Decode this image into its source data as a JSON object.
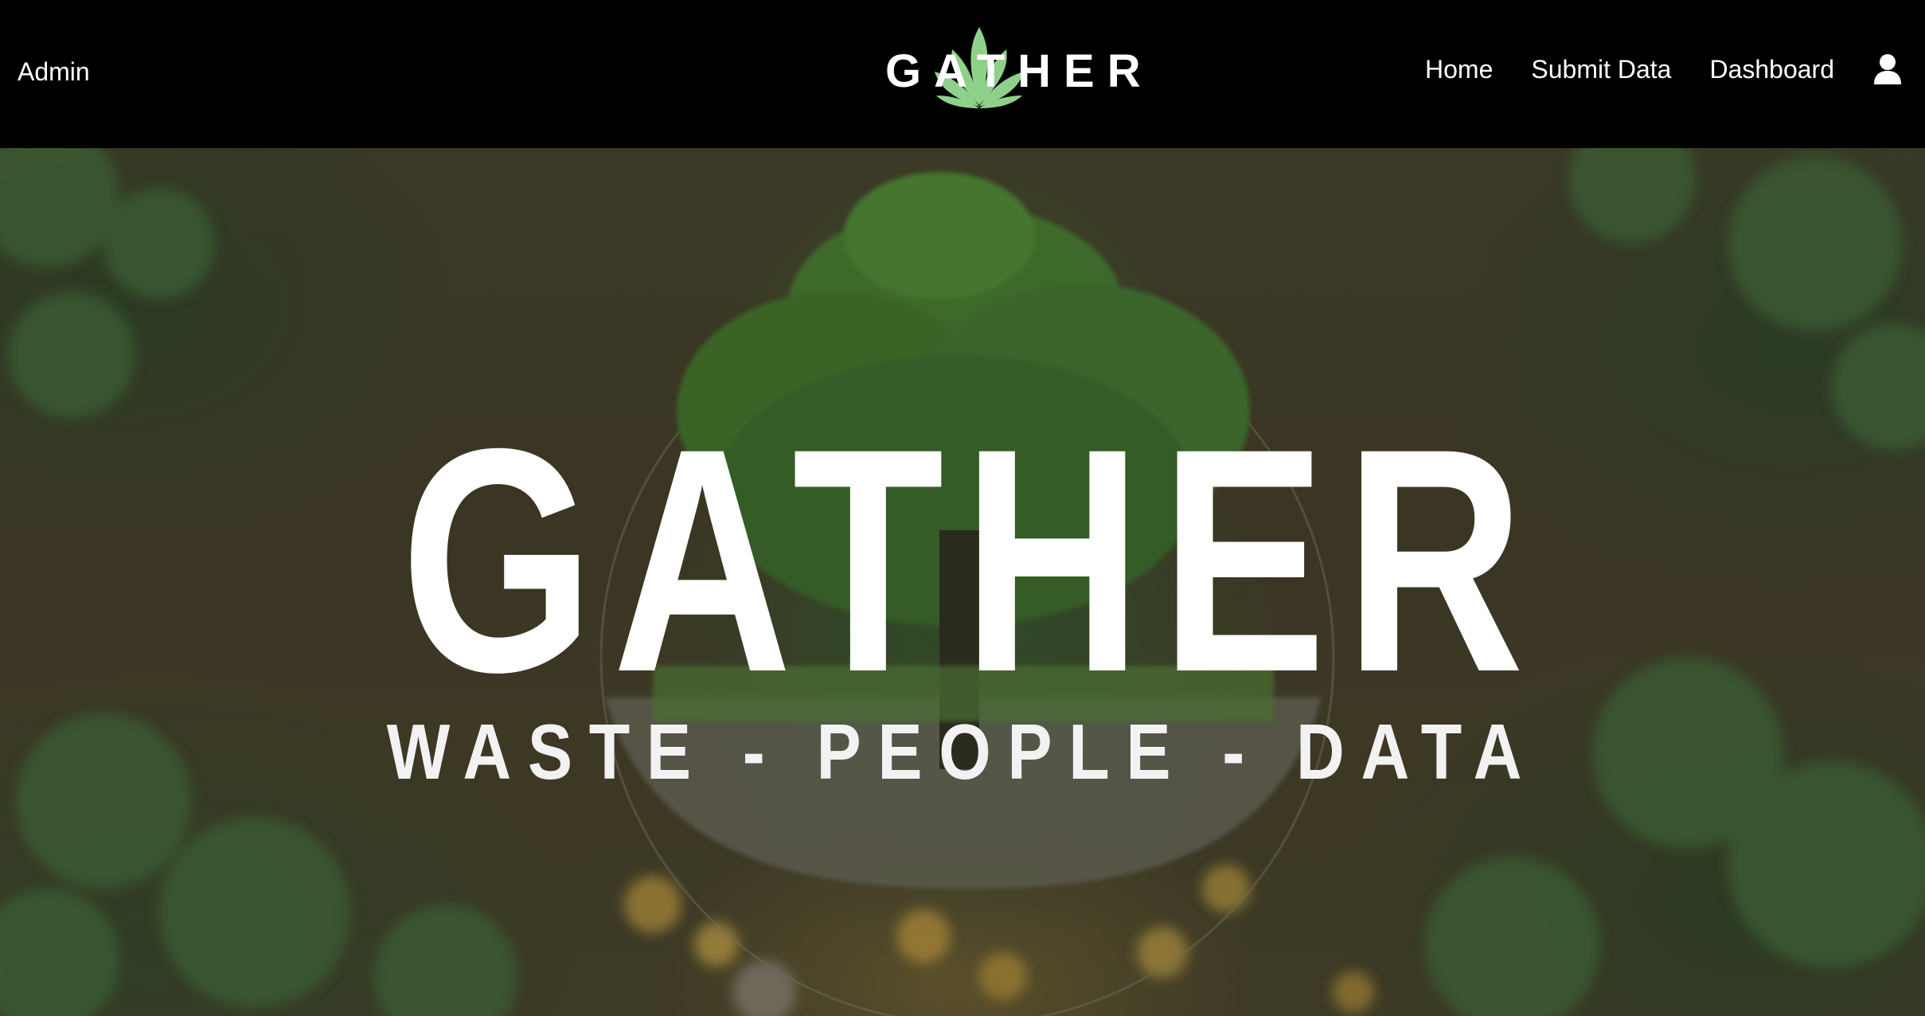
{
  "navbar": {
    "admin_label": "Admin",
    "logo_text": "GATHER",
    "links": [
      "Home",
      "Submit Data",
      "Dashboard"
    ],
    "user_icon": "user-icon"
  },
  "hero": {
    "title": "GATHER",
    "subtitle": "WASTE - PEOPLE - DATA"
  },
  "colors": {
    "navbar_bg": "#000000",
    "text": "#ffffff",
    "logo_leaf": "#8fd08a"
  }
}
